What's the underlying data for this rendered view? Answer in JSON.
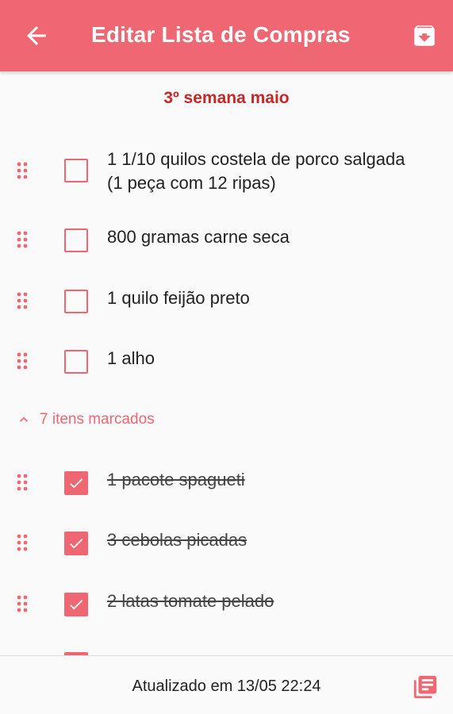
{
  "appbar": {
    "title": "Editar Lista de Compras",
    "back_icon": "arrow-back-icon",
    "archive_icon": "archive-icon",
    "color": "#ee6772"
  },
  "list": {
    "title": "3º semana maio",
    "unchecked_items": [
      {
        "text": "1 1/10 quilos costela de porco salgada (1 peça com 12 ripas)",
        "checked": false
      },
      {
        "text": "800 gramas carne seca",
        "checked": false
      },
      {
        "text": "1 quilo feijão preto",
        "checked": false
      },
      {
        "text": "1 alho",
        "checked": false
      }
    ],
    "checked_section_label": "7 itens marcados",
    "checked_items": [
      {
        "text": "1 pacote spagueti",
        "checked": true
      },
      {
        "text": "3 cebolas picadas",
        "checked": true
      },
      {
        "text": "2 latas tomate pelado",
        "checked": true
      }
    ]
  },
  "footer": {
    "updated": "Atualizado em 13/05 22:24",
    "notes_icon": "notes-icon"
  }
}
